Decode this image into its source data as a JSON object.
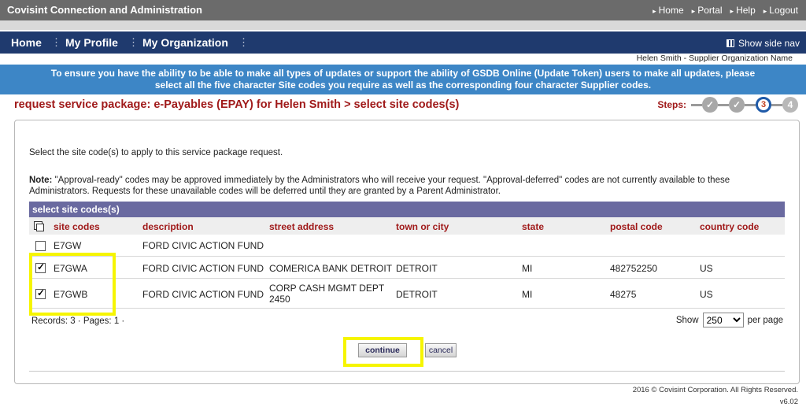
{
  "topbar": {
    "brand": "Covisint Connection and Administration",
    "links": [
      "Home",
      "Portal",
      "Help",
      "Logout"
    ]
  },
  "nav": {
    "items": [
      "Home",
      "My Profile",
      "My Organization"
    ],
    "side_nav": "Show side nav"
  },
  "user_line": "Helen Smith - Supplier Organization Name",
  "banner": {
    "line1": "To ensure you have the ability to be able to make all types of updates or support the ability of GSDB Online (Update Token) users to make all updates, please",
    "line2": "select all the five character Site codes you require as well as the corresponding four character Supplier codes."
  },
  "page_title": "request service package: e-Payables (EPAY) for Helen Smith > select site codes(s)",
  "steps": {
    "label": "Steps:",
    "current": "3",
    "next": "4"
  },
  "intro": "Select the site code(s) to apply to this service package request.",
  "note": {
    "label": "Note:",
    "text": " \"Approval-ready\" codes may be approved immediately by the Administrators who will receive your request. \"Approval-deferred\" codes are not currently available to these Administrators. Requests for these unavailable codes will be deferred until they are granted by a Parent Administrator."
  },
  "grid": {
    "title": "select site codes(s)",
    "columns": [
      "site codes",
      "description",
      "street address",
      "town or city",
      "state",
      "postal code",
      "country code"
    ],
    "rows": [
      {
        "checked": false,
        "site_code": "E7GW",
        "description": "FORD CIVIC ACTION FUND",
        "street_address": "",
        "town": "",
        "state": "",
        "postal": "",
        "country": ""
      },
      {
        "checked": true,
        "site_code": "E7GWA",
        "description": "FORD CIVIC ACTION FUND",
        "street_address": "COMERICA BANK DETROIT",
        "town": "DETROIT",
        "state": "MI",
        "postal": "482752250",
        "country": "US"
      },
      {
        "checked": true,
        "site_code": "E7GWB",
        "description": "FORD CIVIC ACTION FUND",
        "street_address": "CORP CASH MGMT DEPT 2450",
        "town": "DETROIT",
        "state": "MI",
        "postal": "48275",
        "country": "US"
      }
    ],
    "records": "Records: 3 · Pages: 1 ·",
    "show_label": "Show",
    "page_size": "250",
    "per_page": "per page"
  },
  "buttons": {
    "continue": "continue",
    "cancel": "cancel"
  },
  "footer": {
    "copyright": "2016 © Covisint Corporation. All Rights Reserved.",
    "version": "v6.02"
  },
  "colors": {
    "top_bar": "#6b6b6b",
    "nav_bar": "#1f3a6e",
    "banner": "#3d86c6",
    "title_red": "#a01a1a",
    "grid_header": "#6a6aa0",
    "highlight": "#f6f500"
  }
}
